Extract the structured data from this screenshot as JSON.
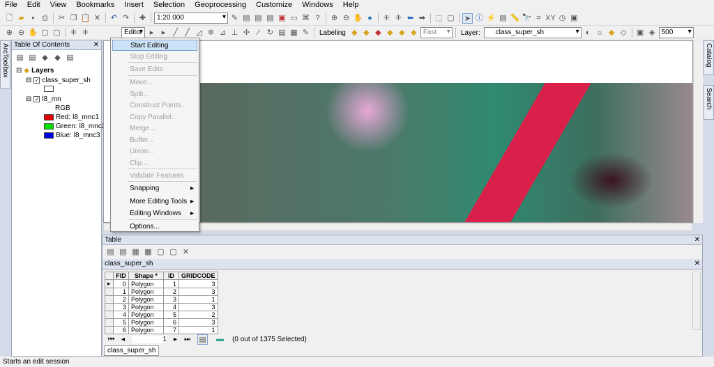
{
  "menubar": [
    "File",
    "Edit",
    "View",
    "Bookmarks",
    "Insert",
    "Selection",
    "Geoprocessing",
    "Customize",
    "Windows",
    "Help"
  ],
  "toolbar": {
    "scale": "1:20.000",
    "editor": "Editor",
    "labeling": "Labeling",
    "fast": "Fast",
    "layer_label": "Layer:",
    "layer": "class_super_sh",
    "ref_scale": "500"
  },
  "toc": {
    "title": "Table Of Contents",
    "side_tab": "ArcToolbox",
    "layers_label": "Layers",
    "layer1": "class_super_sh",
    "layer2": "l8_mn",
    "rgb": "RGB",
    "bands": [
      {
        "label": "Red:",
        "name": "l8_mnc1",
        "color": "#e00000"
      },
      {
        "label": "Green:",
        "name": "l8_mnc2",
        "color": "#00e000"
      },
      {
        "label": "Blue:",
        "name": "l8_mnc3",
        "color": "#0000e0"
      }
    ]
  },
  "right_tabs": [
    "Catalog",
    "Search"
  ],
  "editor_menu": [
    {
      "label": "Start Editing",
      "state": "highlight"
    },
    {
      "label": "Stop Editing",
      "state": "disabled"
    },
    {
      "label": "Save Edits",
      "state": "disabled"
    },
    {
      "label": "Move...",
      "state": "disabled"
    },
    {
      "label": "Split...",
      "state": "disabled"
    },
    {
      "label": "Construct Points...",
      "state": "disabled"
    },
    {
      "label": "Copy Parallel...",
      "state": "disabled"
    },
    {
      "label": "Merge...",
      "state": "disabled"
    },
    {
      "label": "Buffer...",
      "state": "disabled"
    },
    {
      "label": "Union...",
      "state": "disabled"
    },
    {
      "label": "Clip...",
      "state": "disabled"
    },
    {
      "label": "Validate Features",
      "state": "disabled"
    },
    {
      "label": "Snapping",
      "state": "submenu"
    },
    {
      "label": "More Editing Tools",
      "state": "submenu"
    },
    {
      "label": "Editing Windows",
      "state": "submenu"
    },
    {
      "label": "Options...",
      "state": "normal"
    }
  ],
  "table": {
    "title": "Table",
    "layer_tab": "class_super_sh",
    "columns": [
      "FID",
      "Shape *",
      "ID",
      "GRIDCODE"
    ],
    "rows": [
      [
        "0",
        "Polygon",
        "1",
        "3"
      ],
      [
        "1",
        "Polygon",
        "2",
        "3"
      ],
      [
        "2",
        "Polygon",
        "3",
        "1"
      ],
      [
        "3",
        "Polygon",
        "4",
        "3"
      ],
      [
        "4",
        "Polygon",
        "5",
        "2"
      ],
      [
        "5",
        "Polygon",
        "6",
        "3"
      ],
      [
        "6",
        "Polygon",
        "7",
        "1"
      ]
    ],
    "record": "1",
    "selected": "(0 out of 1375 Selected)",
    "bottom_tab": "class_super_sh"
  },
  "status": "Starts an edit session"
}
